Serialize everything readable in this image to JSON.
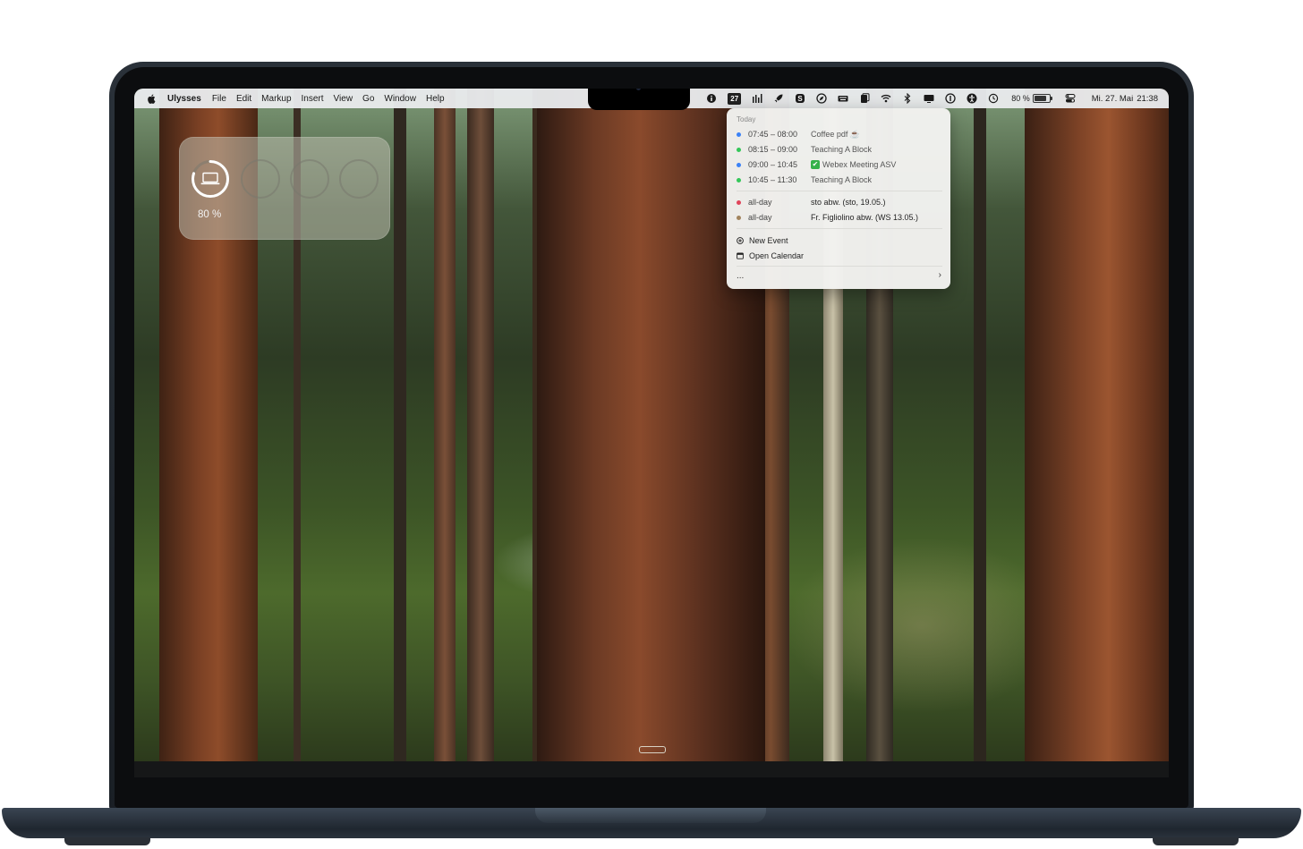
{
  "menubar": {
    "app_name": "Ulysses",
    "menus": [
      "File",
      "Edit",
      "Markup",
      "Insert",
      "View",
      "Go",
      "Window",
      "Help"
    ],
    "calendar_icon_day": "27",
    "battery_percent": "80 %",
    "battery_level": 0.8,
    "date": "Mi. 27. Mai",
    "time": "21:38",
    "status_icons": [
      "info-icon",
      "calendar-icon",
      "bar-chart-icon",
      "rocket-icon",
      "skype-icon",
      "compass-icon",
      "keyboard-icon",
      "clipboard-icon",
      "wifi-icon",
      "bluetooth-icon",
      "display-icon",
      "one-password-icon",
      "accessibility-icon",
      "time-machine-icon",
      "battery-icon",
      "control-center-icon"
    ]
  },
  "battery_widget": {
    "percent_label": "80 %",
    "level": 0.8
  },
  "calendar_dropdown": {
    "header": "Today",
    "timed_events": [
      {
        "time": "07:45 – 08:00",
        "title": "Coffee pdf ☕",
        "color": "#3b82f6"
      },
      {
        "time": "08:15 – 09:00",
        "title": "Teaching A Block",
        "color": "#34c759"
      },
      {
        "time": "09:00 – 10:45",
        "title": "Webex Meeting ASV",
        "color": "#3b82f6",
        "checkmark": "✔"
      },
      {
        "time": "10:45 – 11:30",
        "title": "Teaching A Block",
        "color": "#34c759"
      }
    ],
    "allday_events": [
      {
        "time": "all-day",
        "title": "sto abw. (sto, 19.05.)",
        "color": "#e0445a"
      },
      {
        "time": "all-day",
        "title": "Fr. Figliolino abw. (WS 13.05.)",
        "color": "#a2845e"
      }
    ],
    "actions": {
      "new_event": "New Event",
      "open_calendar": "Open Calendar"
    },
    "more_label": "...",
    "chevron": "›"
  }
}
